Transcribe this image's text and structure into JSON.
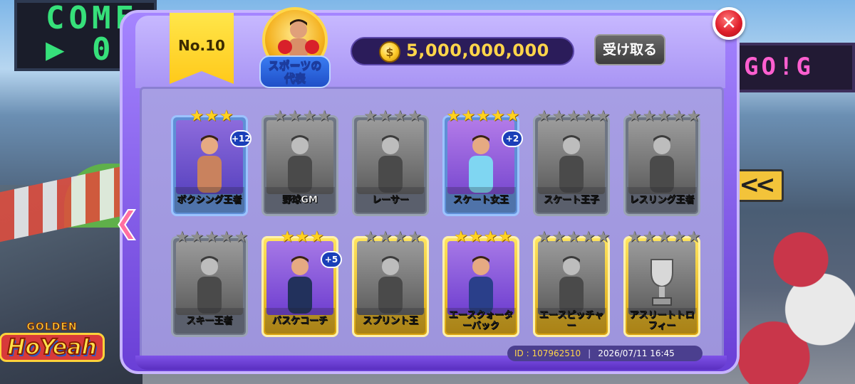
{
  "background": {
    "left_scoreboard_text": "COME\n▶ 0",
    "right_scoreboard_text": "GO!G",
    "chevron_sign": "<<"
  },
  "logo": {
    "top": "GOLDEN",
    "main": "HoYeah"
  },
  "header": {
    "rank_label": "No.10",
    "category_label": "スポーツの\n代表",
    "coin_amount": "5,000,000,000",
    "receive_label": "受け取る",
    "close_glyph": "✕"
  },
  "nav": {
    "prev_glyph": "❮"
  },
  "cards": [
    {
      "label": "ボクシング王者",
      "stars": 3,
      "max_stars": 3,
      "plus": "+12",
      "state": "owned",
      "frame": "blue",
      "art": "boxer"
    },
    {
      "label": "野球GM",
      "stars": 0,
      "max_stars": 4,
      "plus": "",
      "state": "locked",
      "frame": "gray",
      "art": "gm"
    },
    {
      "label": "レーサー",
      "stars": 0,
      "max_stars": 4,
      "plus": "",
      "state": "locked",
      "frame": "gray",
      "art": "racer"
    },
    {
      "label": "スケート女王",
      "stars": 5,
      "max_stars": 5,
      "plus": "+2",
      "state": "owned",
      "frame": "blue",
      "art": "skater-queen"
    },
    {
      "label": "スケート王子",
      "stars": 0,
      "max_stars": 5,
      "plus": "",
      "state": "locked",
      "frame": "gray",
      "art": "skater-prince"
    },
    {
      "label": "レスリング王者",
      "stars": 0,
      "max_stars": 5,
      "plus": "",
      "state": "locked",
      "frame": "gray",
      "art": "wrestler"
    },
    {
      "label": "スキー王者",
      "stars": 0,
      "max_stars": 5,
      "plus": "",
      "state": "locked",
      "frame": "gray",
      "art": "skier"
    },
    {
      "label": "バスケコーチ",
      "stars": 3,
      "max_stars": 3,
      "plus": "+5",
      "state": "owned",
      "frame": "gold",
      "art": "coach"
    },
    {
      "label": "スプリント王",
      "stars": 0,
      "max_stars": 4,
      "plus": "",
      "state": "locked",
      "frame": "gold",
      "art": "sprinter"
    },
    {
      "label": "エースクォーターバック",
      "stars": 4,
      "max_stars": 4,
      "plus": "",
      "state": "owned",
      "frame": "gold",
      "art": "quarterback"
    },
    {
      "label": "エースピッチャー",
      "stars": 0,
      "max_stars": 5,
      "plus": "",
      "state": "locked",
      "frame": "gold",
      "art": "pitcher"
    },
    {
      "label": "アスリートトロフィー",
      "stars": 0,
      "max_stars": 5,
      "plus": "",
      "state": "locked",
      "frame": "gold",
      "art": "trophy"
    }
  ],
  "footer": {
    "id_label": "ID : 107962510",
    "separator": "|",
    "timestamp": "2026/07/11 16:45"
  },
  "colors": {
    "star_on": "#ffd21f",
    "star_off": "#8e8e8e",
    "coin": "#ffd54a",
    "panel": "#a585ff",
    "close": "#e01f2c"
  }
}
